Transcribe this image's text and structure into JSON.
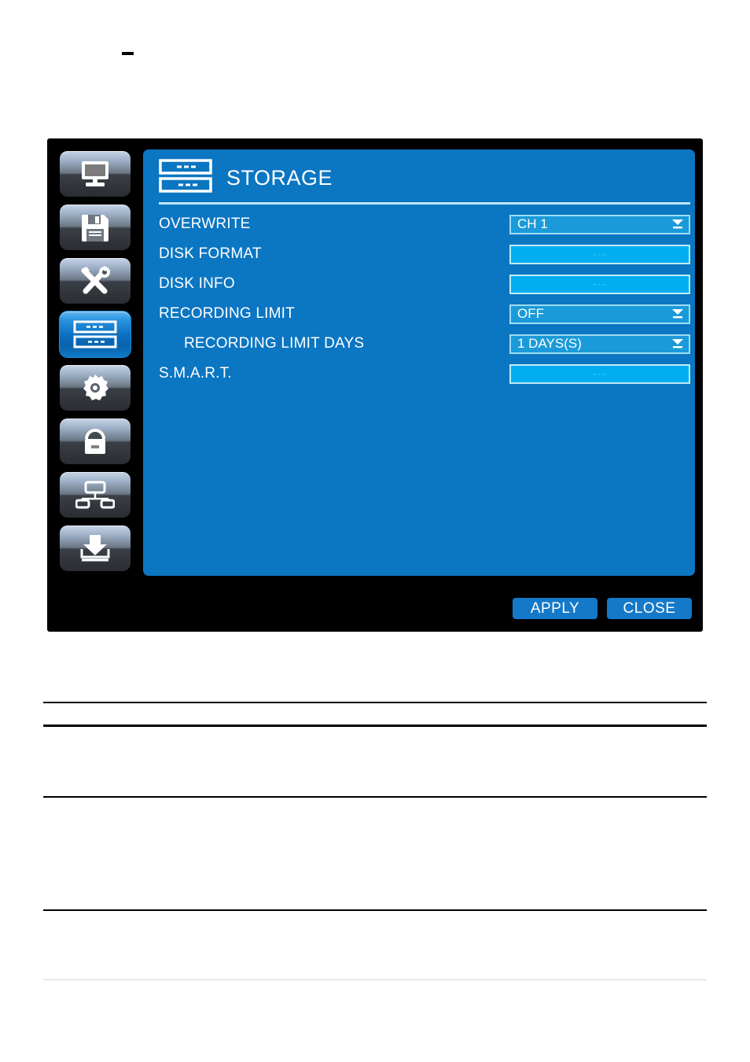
{
  "page": {
    "stray_mark": "-"
  },
  "dialog": {
    "title": "STORAGE",
    "title_icon": "storage-rack-icon",
    "colors": {
      "panel_blue": "#0b76c2",
      "select_field_blue": "#1a9ad9",
      "action_field_blue": "#00aeef",
      "field_border": "#9fdcf5",
      "button_blue": "#1479c9",
      "frame_black": "#000000",
      "text_white": "#ffffff"
    },
    "sidebar": {
      "items": [
        {
          "name": "display",
          "icon": "monitor-icon",
          "selected": false
        },
        {
          "name": "record",
          "icon": "floppy-disk-icon",
          "selected": false
        },
        {
          "name": "tools",
          "icon": "tools-icon",
          "selected": false
        },
        {
          "name": "storage",
          "icon": "storage-rack-icon",
          "selected": true
        },
        {
          "name": "system",
          "icon": "gear-icon",
          "selected": false
        },
        {
          "name": "security",
          "icon": "lock-icon",
          "selected": false
        },
        {
          "name": "network",
          "icon": "network-icon",
          "selected": false
        },
        {
          "name": "backup",
          "icon": "download-icon",
          "selected": false
        }
      ]
    },
    "rows": [
      {
        "label": "OVERWRITE",
        "value": "CH 1",
        "type": "select",
        "indent": false
      },
      {
        "label": "DISK FORMAT",
        "value": "---",
        "type": "action",
        "indent": false
      },
      {
        "label": "DISK INFO",
        "value": "---",
        "type": "action",
        "indent": false
      },
      {
        "label": "RECORDING LIMIT",
        "value": "OFF",
        "type": "select",
        "indent": false
      },
      {
        "label": "RECORDING LIMIT DAYS",
        "value": "1 DAYS(S)",
        "type": "select",
        "indent": true
      },
      {
        "label": "S.M.A.R.T.",
        "value": "---",
        "type": "action",
        "indent": false
      }
    ],
    "footer": {
      "apply_label": "APPLY",
      "close_label": "CLOSE"
    }
  }
}
